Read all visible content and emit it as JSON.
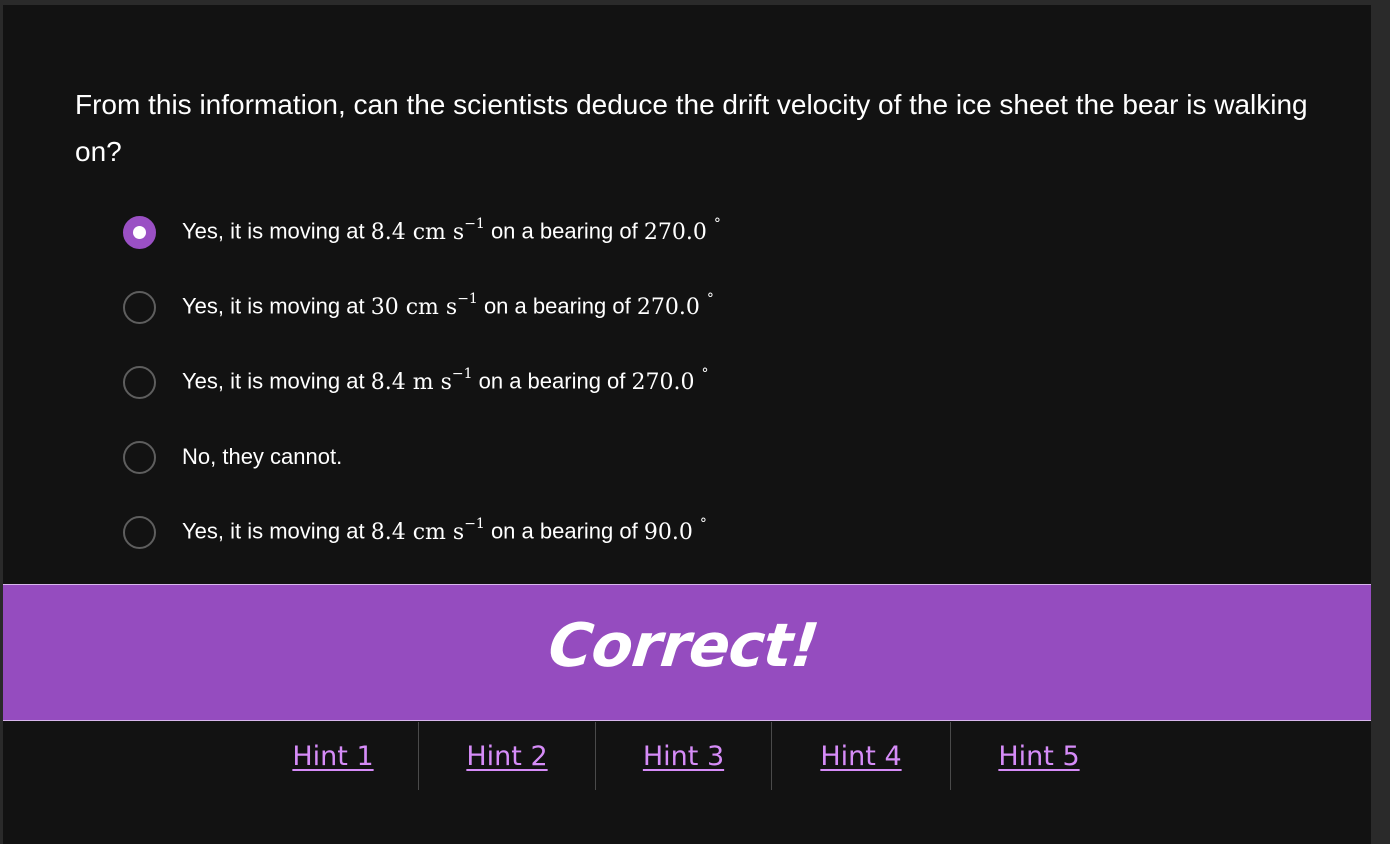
{
  "question": {
    "text": "From this information, can the scientists deduce the drift velocity of the ice sheet the bear is walking on?"
  },
  "options": [
    {
      "checked": true,
      "prefix": "Yes, it is moving at ",
      "value": "8.4",
      "unit": "cm s",
      "exp": "−1",
      "mid": " on a bearing of ",
      "bearing": "270.0",
      "deg": "°"
    },
    {
      "checked": false,
      "prefix": "Yes, it is moving at ",
      "value": "30",
      "unit": "cm s",
      "exp": "−1",
      "mid": " on a bearing of ",
      "bearing": "270.0",
      "deg": "°"
    },
    {
      "checked": false,
      "prefix": "Yes, it is moving at ",
      "value": "8.4",
      "unit": "m s",
      "exp": "−1",
      "mid": " on a bearing of ",
      "bearing": "270.0",
      "deg": "°"
    },
    {
      "checked": false,
      "plain": "No, they cannot."
    },
    {
      "checked": false,
      "prefix": "Yes, it is moving at ",
      "value": "8.4",
      "unit": "cm s",
      "exp": "−1",
      "mid": " on a bearing of ",
      "bearing": "90.0",
      "deg": "°"
    }
  ],
  "feedback": {
    "text": "Correct!",
    "color": "#954cbf"
  },
  "hints": [
    {
      "label": "Hint 1"
    },
    {
      "label": "Hint 2"
    },
    {
      "label": "Hint 3"
    },
    {
      "label": "Hint 4"
    },
    {
      "label": "Hint 5"
    }
  ],
  "colors": {
    "accent": "#9a50c4",
    "link": "#d68cf8",
    "background": "#121212"
  }
}
